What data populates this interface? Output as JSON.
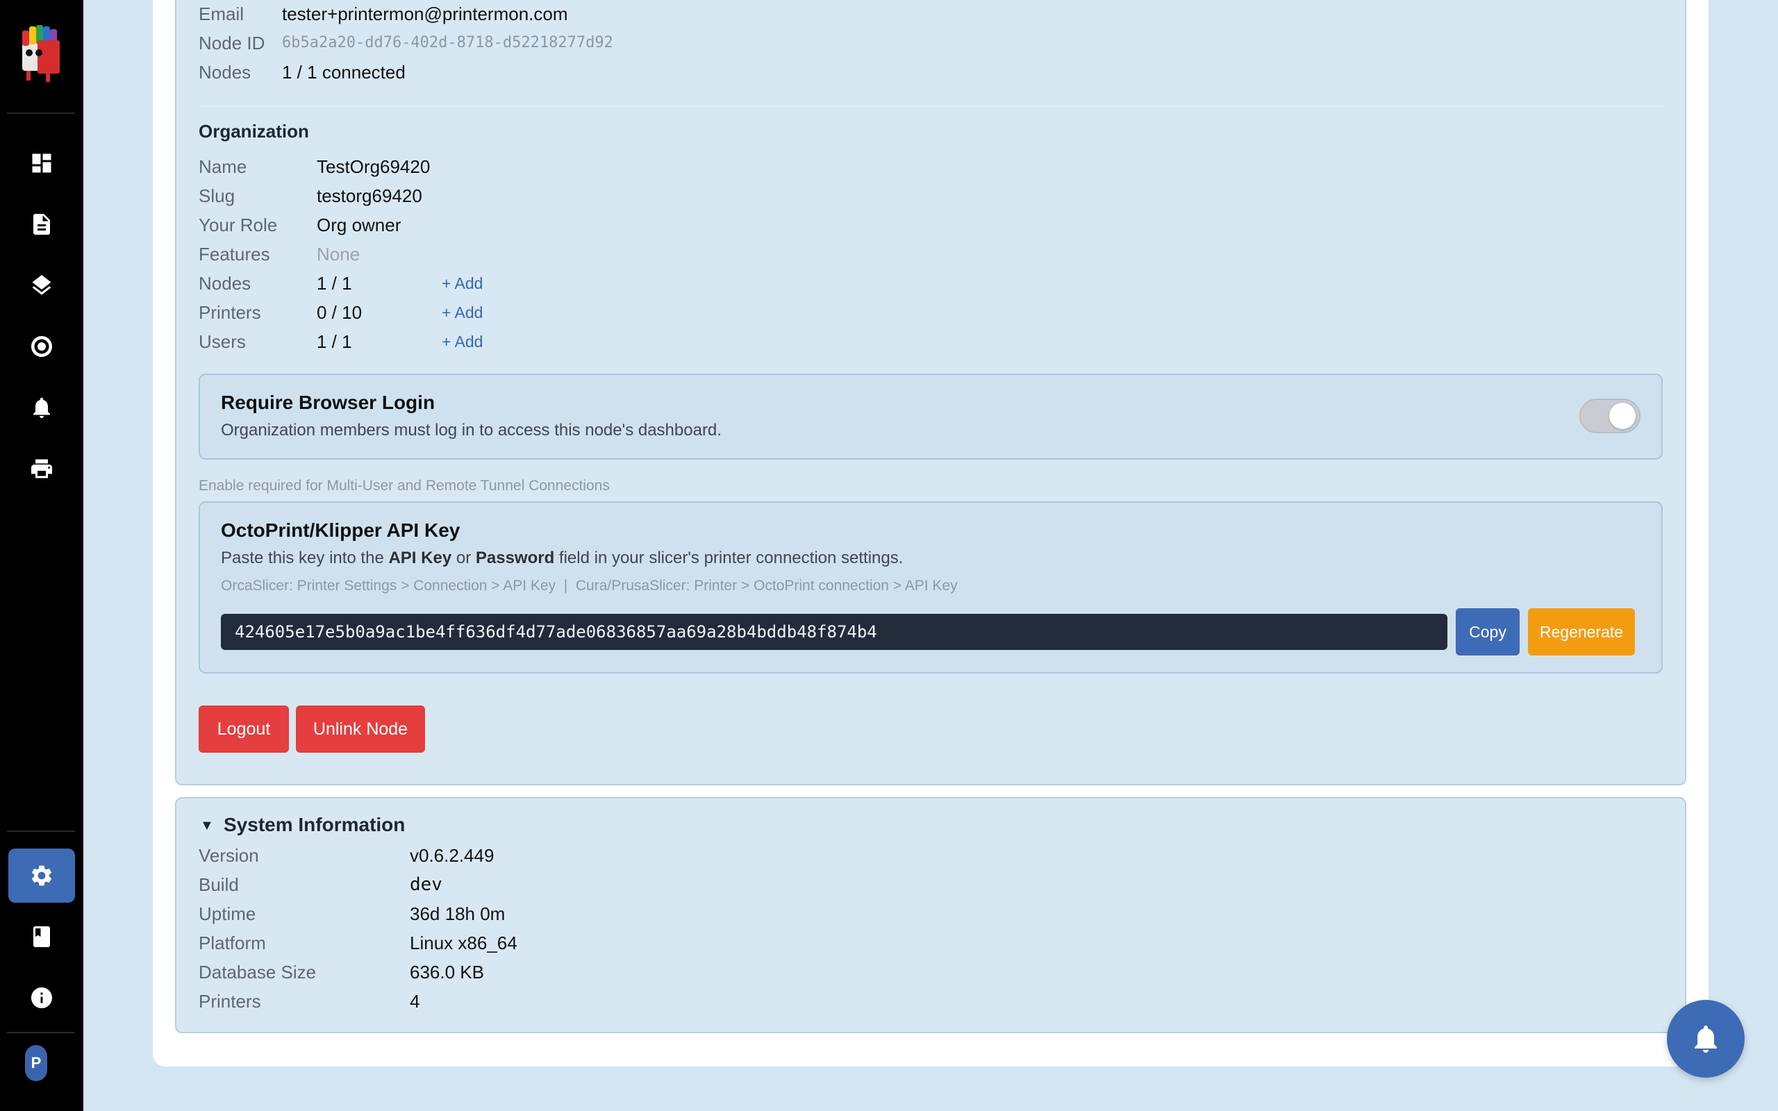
{
  "sidebar": {
    "nav": [
      {
        "icon": "dashboard-icon"
      },
      {
        "icon": "document-icon"
      },
      {
        "icon": "layers-icon"
      },
      {
        "icon": "target-icon"
      },
      {
        "icon": "bell-icon"
      },
      {
        "icon": "printer-icon"
      }
    ],
    "bottom": [
      {
        "icon": "gear-icon",
        "active": true
      },
      {
        "icon": "book-icon"
      },
      {
        "icon": "info-icon"
      }
    ],
    "avatar_letter": "P"
  },
  "account": {
    "email_label": "Email",
    "email": "tester+printermon@printermon.com",
    "node_id_label": "Node ID",
    "node_id": "6b5a2a20-dd76-402d-8718-d52218277d92",
    "nodes_label": "Nodes",
    "nodes": "1 / 1 connected"
  },
  "organization": {
    "title": "Organization",
    "name_label": "Name",
    "name": "TestOrg69420",
    "slug_label": "Slug",
    "slug": "testorg69420",
    "role_label": "Your Role",
    "role": "Org owner",
    "features_label": "Features",
    "features": "None",
    "nodes_label": "Nodes",
    "nodes": "1 / 1",
    "printers_label": "Printers",
    "printers": "0 / 10",
    "users_label": "Users",
    "users": "1 / 1",
    "add_label": "+ Add"
  },
  "browser_login": {
    "title": "Require Browser Login",
    "description": "Organization members must log in to access this node's dashboard.",
    "enabled": true,
    "note": "Enable required for Multi-User and Remote Tunnel Connections"
  },
  "api_key": {
    "title": "OctoPrint/Klipper API Key",
    "desc_prefix": "Paste this key into the ",
    "desc_key": "API Key",
    "desc_or": " or ",
    "desc_password": "Password",
    "desc_suffix": " field in your slicer's printer connection settings.",
    "hint": "OrcaSlicer: Printer Settings > Connection > API Key  |  Cura/PrusaSlicer: Printer > OctoPrint connection > API Key",
    "value": "424605e17e5b0a9ac1be4ff636df4d77ade06836857aa69a28b4bddb48f874b4",
    "copy_label": "Copy",
    "regenerate_label": "Regenerate"
  },
  "actions": {
    "logout_label": "Logout",
    "unlink_label": "Unlink Node"
  },
  "system": {
    "title": "System Information",
    "rows": [
      {
        "label": "Version",
        "value": "v0.6.2.449"
      },
      {
        "label": "Build",
        "value": "dev"
      },
      {
        "label": "Uptime",
        "value": "36d 18h 0m"
      },
      {
        "label": "Platform",
        "value": "Linux x86_64"
      },
      {
        "label": "Database Size",
        "value": "636.0 KB"
      },
      {
        "label": "Printers",
        "value": "4"
      }
    ]
  },
  "colors": {
    "accent": "#3e6bb5",
    "danger": "#e53e3e",
    "warning": "#f39c12",
    "sidebar_bg": "#000000",
    "page_bg": "#d4e5f2"
  }
}
